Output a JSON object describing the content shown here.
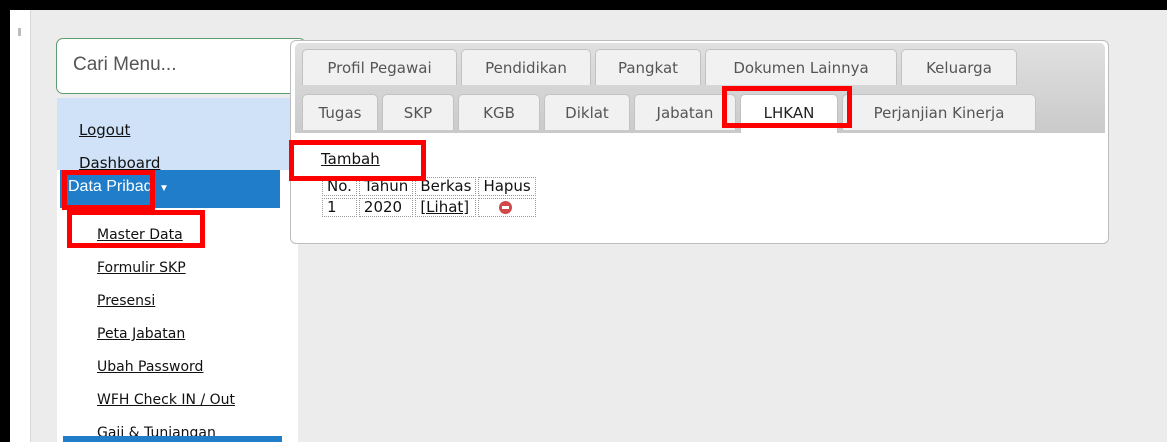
{
  "search": {
    "placeholder": "Cari Menu..."
  },
  "sidebar": {
    "top_links": [
      "Logout",
      "Dashboard"
    ],
    "active": {
      "label": "Data Pribadi"
    },
    "sub_items": [
      "Master Data",
      "Formulir SKP",
      "Presensi",
      "Peta Jabatan",
      "Ubah Password",
      "WFH Check IN / Out",
      "Gaji & Tunjangan"
    ]
  },
  "tabs": {
    "row1": [
      "Profil Pegawai",
      "Pendidikan",
      "Pangkat",
      "Dokumen Lainnya",
      "Keluarga"
    ],
    "row2": [
      "Tugas",
      "SKP",
      "KGB",
      "Diklat",
      "Jabatan",
      "LHKAN",
      "Perjanjian Kinerja"
    ],
    "active": "LHKAN"
  },
  "content": {
    "add_link": "Tambah",
    "table": {
      "headers": [
        "No.",
        "Tahun",
        "Berkas",
        "Hapus"
      ],
      "rows": [
        {
          "no": "1",
          "tahun": "2020",
          "berkas": "[Lihat]"
        }
      ]
    }
  },
  "colors": {
    "highlight": "#ff0000",
    "menu_active": "#1f7dca",
    "menu_top": "#cfe2f7"
  },
  "icons": {
    "delete": "delete-icon",
    "caret": "caret-down-icon"
  }
}
